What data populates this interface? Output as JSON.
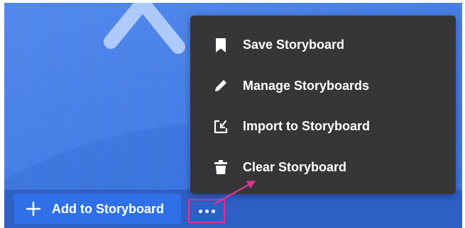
{
  "toolbar": {
    "add_label": "Add to Storyboard",
    "more_icon": "more-dots-icon"
  },
  "menu": {
    "items": [
      {
        "label": "Save Storyboard",
        "icon": "bookmark-icon"
      },
      {
        "label": "Manage Storyboards",
        "icon": "pencil-icon"
      },
      {
        "label": "Import to Storyboard",
        "icon": "import-icon"
      },
      {
        "label": "Clear Storyboard",
        "icon": "trash-icon"
      }
    ]
  },
  "colors": {
    "background": "#4179e6",
    "bottom_bar": "#2d5fc4",
    "primary_button": "#2f70e8",
    "menu_background": "#363638",
    "highlight": "#e0348f",
    "text": "#ffffff"
  }
}
